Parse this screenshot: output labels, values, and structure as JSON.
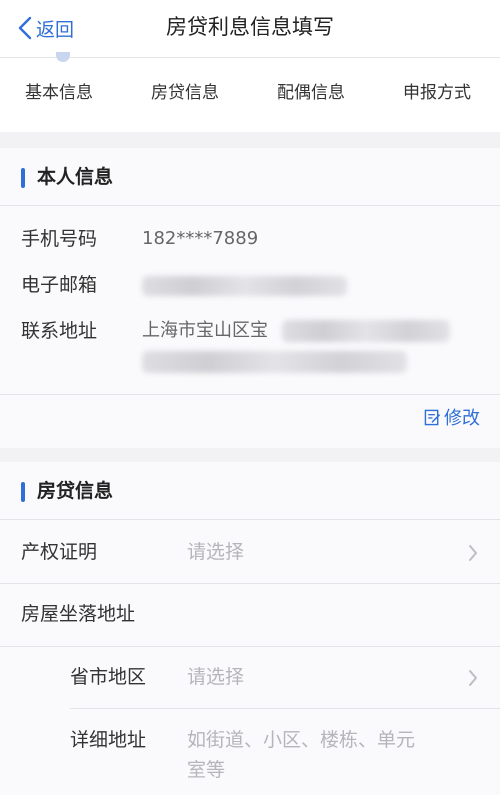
{
  "header": {
    "back_label": "返回",
    "title": "房贷利息信息填写"
  },
  "steps": [
    {
      "label": "基本信息"
    },
    {
      "label": "房贷信息"
    },
    {
      "label": "配偶信息"
    },
    {
      "label": "申报方式"
    }
  ],
  "personal": {
    "title": "本人信息",
    "phone_label": "手机号码",
    "phone_value": "182****7889",
    "email_label": "电子邮箱",
    "address_label": "联系地址",
    "address_value": "上海市宝山区宝",
    "edit_label": "修改"
  },
  "loan": {
    "title": "房贷信息",
    "property_label": "产权证明",
    "property_placeholder": "请选择",
    "location_label": "房屋坐落地址",
    "region_label": "省市地区",
    "region_placeholder": "请选择",
    "detail_label": "详细地址",
    "detail_placeholder_line1": "如街道、小区、楼栋、单元",
    "detail_placeholder_line2": "室等"
  },
  "colors": {
    "accent": "#2f6fd6",
    "placeholder": "#b5b5bb",
    "background": "#f2f2f4"
  }
}
